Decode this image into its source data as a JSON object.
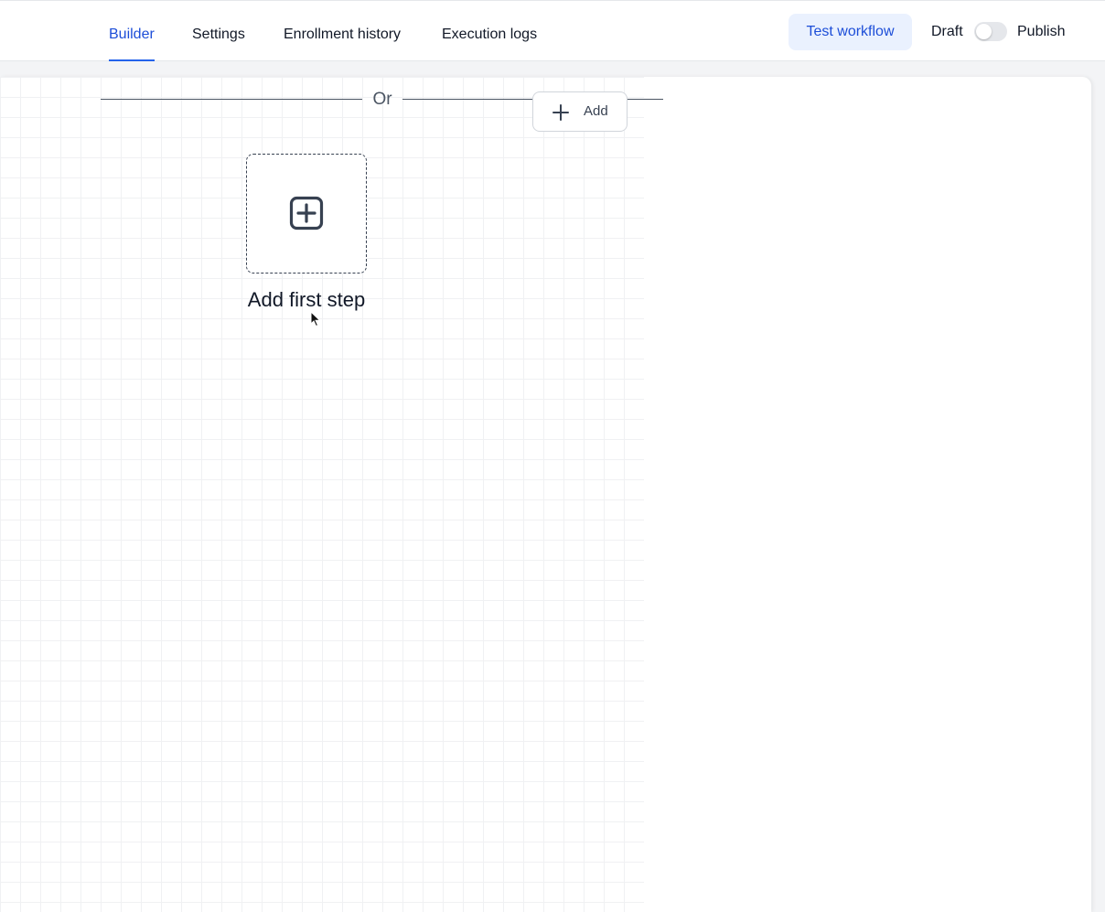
{
  "tabs": [
    {
      "label": "Builder",
      "active": true
    },
    {
      "label": "Settings",
      "active": false
    },
    {
      "label": "Enrollment history",
      "active": false
    },
    {
      "label": "Execution logs",
      "active": false
    }
  ],
  "actions": {
    "test_workflow_label": "Test workflow",
    "draft_label": "Draft",
    "publish_label": "Publish",
    "publish_toggle_on": false
  },
  "canvas": {
    "divider_text": "Or",
    "add_button_label": "Add",
    "first_step_label": "Add first step"
  },
  "icons": {
    "add_button_icon": "plus-icon",
    "first_step_icon": "square-plus-icon",
    "pointer": "mouse-cursor-icon"
  },
  "colors": {
    "accent": "#2563eb",
    "accent_text": "#1d4ed8",
    "accent_bg": "#eaf1fe",
    "divider": "#4b5563",
    "grid_line": "#f0f1f3"
  }
}
